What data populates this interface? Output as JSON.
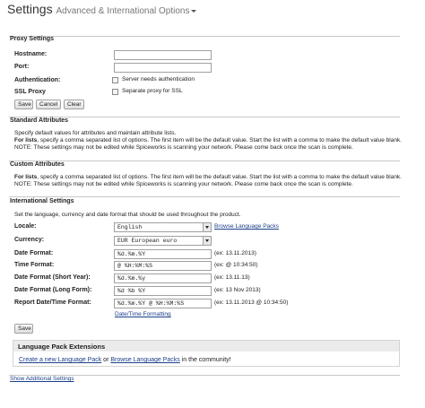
{
  "header": {
    "title": "Settings",
    "subtitle": "Advanced & International Options"
  },
  "proxy": {
    "heading": "Proxy Settings",
    "hostname_label": "Hostname:",
    "port_label": "Port:",
    "auth_label": "Authentication:",
    "ssl_label": "SSL Proxy",
    "server_auth_text": "Server needs authentication",
    "separate_ssl_text": "Separate proxy for SSL",
    "hostname_value": "",
    "port_value": "",
    "server_auth_checked": false,
    "separate_ssl_checked": false,
    "save": "Save",
    "cancel": "Cancel",
    "clear": "Clear"
  },
  "standard": {
    "heading": "Standard Attributes",
    "line1": "Specify default values for attributes and maintain attribute lists.",
    "line2_bold": "For lists",
    "line2_rest": ", specify a comma separated list of options. The first item will be the default value. Start the list with a comma to make the default value blank.",
    "line3": "NOTE: These settings may not be edited while Spiceworks is scanning your network. Please come back once the scan is complete."
  },
  "custom": {
    "heading": "Custom Attributes",
    "line1_bold": "For lists",
    "line1_rest": ", specify a comma separated list of options. The first item will be the default value. Start the list with a comma to make the default value blank.",
    "line2": "NOTE: These settings may not be edited while Spiceworks is scanning your network. Please come back once the scan is complete."
  },
  "international": {
    "heading": "International Settings",
    "intro": "Set the language, currency and date format that should be used throughout the product.",
    "locale_label": "Locale:",
    "locale_value": "English",
    "browse_packs": "Browse Language Packs",
    "currency_label": "Currency:",
    "currency_value": "EUR European euro",
    "date_label": "Date Format:",
    "date_value": "%d.%m.%Y",
    "date_example": "(ex: 13.11.2013)",
    "time_label": "Time Format:",
    "time_value": "@ %H:%M:%S",
    "time_example": "(ex: @ 10:34:50)",
    "date_short_label": "Date Format (Short Year):",
    "date_short_value": "%d.%m.%y",
    "date_short_example": "(ex: 13.11.13)",
    "date_long_label": "Date Format (Long Form):",
    "date_long_value": "%d %b %Y",
    "date_long_example": "(ex: 13 Nov 2013)",
    "report_label": "Report Date/Time Format:",
    "report_value": "%d.%m.%Y @ %H:%M:%S",
    "report_example": "(ex: 13.11.2013 @ 10:34:50)",
    "formatting_link": "Date/Time Formatting",
    "save": "Save"
  },
  "extensions": {
    "heading": "Language Pack Extensions",
    "create_link": "Create a new Language Pack",
    "or_text": " or ",
    "browse_link": "Browse Language Packs",
    "tail_text": " in the community!"
  },
  "footer": {
    "show_additional": "Show Additional Settings"
  }
}
